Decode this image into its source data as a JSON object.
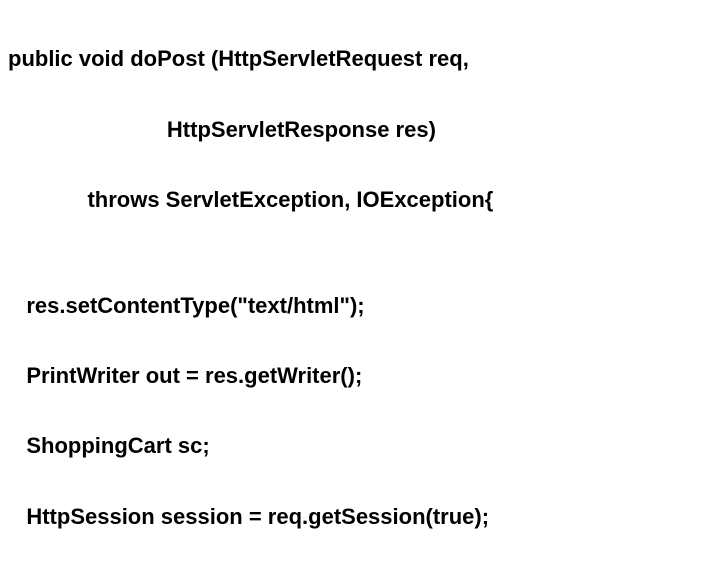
{
  "code": {
    "lines": [
      "public void doPost (HttpServletRequest req,",
      "                          HttpServletResponse res)",
      "             throws ServletException, IOException{",
      "",
      "   res.setContentType(\"text/html\");",
      "   PrintWriter out = res.getWriter();",
      "   ShoppingCart sc;",
      "   HttpSession session = req.getSession(true);"
    ]
  }
}
